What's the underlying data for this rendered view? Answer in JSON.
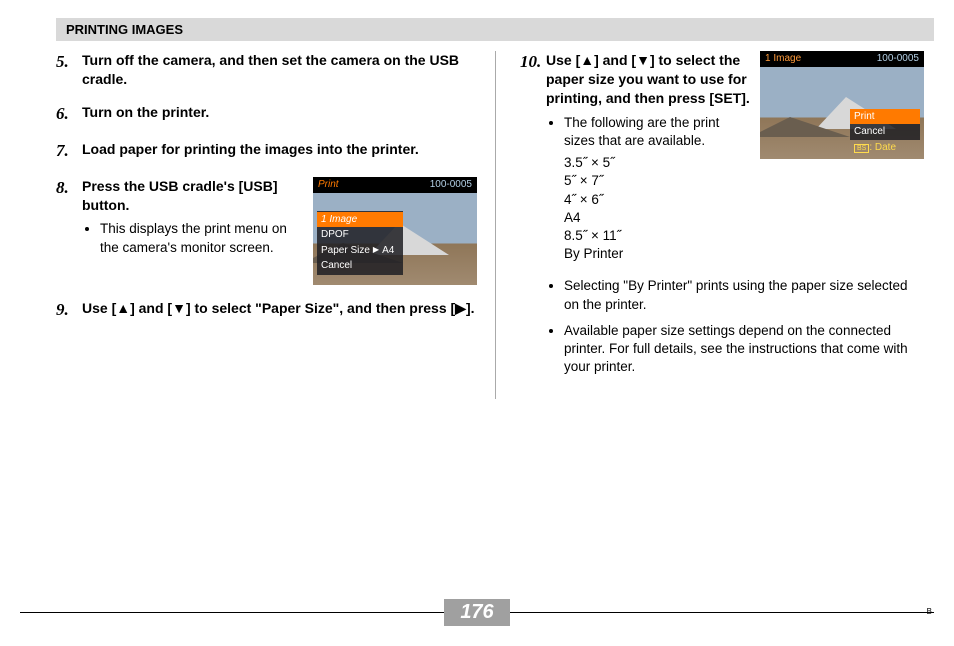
{
  "header": "PRINTING IMAGES",
  "steps_left": [
    {
      "n": "5.",
      "main": "Turn off the camera, and then set the camera on the USB cradle."
    },
    {
      "n": "6.",
      "main": "Turn on the printer."
    },
    {
      "n": "7.",
      "main": "Load paper for printing the images into the printer."
    }
  ],
  "step8": {
    "n": "8.",
    "main": "Press the USB cradle's [USB] button.",
    "bullet": "This displays the print menu on the camera's monitor screen."
  },
  "step9": {
    "n": "9.",
    "main": "Use [▲] and [▼] to select \"Paper Size\", and then press [▶]."
  },
  "step10": {
    "n": "10.",
    "main": "Use [▲] and [▼] to select the paper size you want to use for printing, and then press [SET].",
    "bullet_intro": "The following are the print sizes that are available.",
    "sizes": [
      "3.5˝ × 5˝",
      "5˝ × 7˝",
      "4˝ × 6˝",
      "A4",
      "8.5˝ × 11˝",
      "By Printer"
    ],
    "bullet2": "Selecting \"By Printer\" prints using the paper size selected on the printer.",
    "bullet3": "Available paper size settings depend on the connected printer. For full details, see the instructions that come with your printer."
  },
  "screenshot_menu": {
    "top_left": "Print",
    "top_right": "100-0005",
    "sel": "1 Image",
    "rows": [
      "DPOF",
      "Paper Size",
      "Cancel"
    ],
    "paper_val": "A4"
  },
  "screenshot_print": {
    "top_left": "1 Image",
    "top_right": "100-0005",
    "sel": "Print",
    "row": "Cancel",
    "date_key": "BS",
    "date_val": ": Date"
  },
  "page_number": "176",
  "corner": "B"
}
